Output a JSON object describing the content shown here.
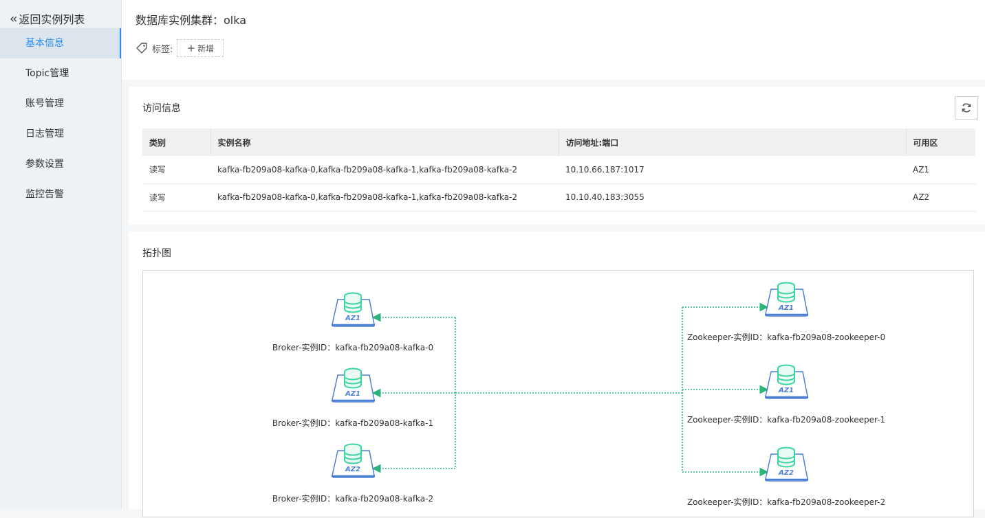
{
  "sidebar": {
    "back_label": "返回实例列表",
    "items": [
      {
        "label": "基本信息",
        "active": true
      },
      {
        "label": "Topic管理",
        "active": false
      },
      {
        "label": "账号管理",
        "active": false
      },
      {
        "label": "日志管理",
        "active": false
      },
      {
        "label": "参数设置",
        "active": false
      },
      {
        "label": "监控告警",
        "active": false
      }
    ]
  },
  "header": {
    "title": "数据库实例集群：olka",
    "tag_label": "标签:",
    "add_tag_label": "新增"
  },
  "access": {
    "title": "访问信息",
    "columns": [
      "类别",
      "实例名称",
      "访问地址:端口",
      "可用区"
    ],
    "rows": [
      [
        "读写",
        "kafka-fb209a08-kafka-0,kafka-fb209a08-kafka-1,kafka-fb209a08-kafka-2",
        "10.10.66.187:1017",
        "AZ1"
      ],
      [
        "读写",
        "kafka-fb209a08-kafka-0,kafka-fb209a08-kafka-1,kafka-fb209a08-kafka-2",
        "10.10.40.183:3055",
        "AZ2"
      ]
    ]
  },
  "topology": {
    "title": "拓扑图",
    "brokers": [
      {
        "label": "Broker-实例ID：kafka-fb209a08-kafka-0",
        "az": "AZ1"
      },
      {
        "label": "Broker-实例ID：kafka-fb209a08-kafka-1",
        "az": "AZ1"
      },
      {
        "label": "Broker-实例ID：kafka-fb209a08-kafka-2",
        "az": "AZ2"
      }
    ],
    "zookeepers": [
      {
        "label": "Zookeeper-实例ID：kafka-fb209a08-zookeeper-0",
        "az": "AZ1"
      },
      {
        "label": "Zookeeper-实例ID：kafka-fb209a08-zookeeper-1",
        "az": "AZ1"
      },
      {
        "label": "Zookeeper-实例ID：kafka-fb209a08-zookeeper-2",
        "az": "AZ2"
      }
    ],
    "colors": {
      "link": "#2bb37a",
      "node": "#3ad6a0",
      "base": "#4a7fd4"
    }
  }
}
